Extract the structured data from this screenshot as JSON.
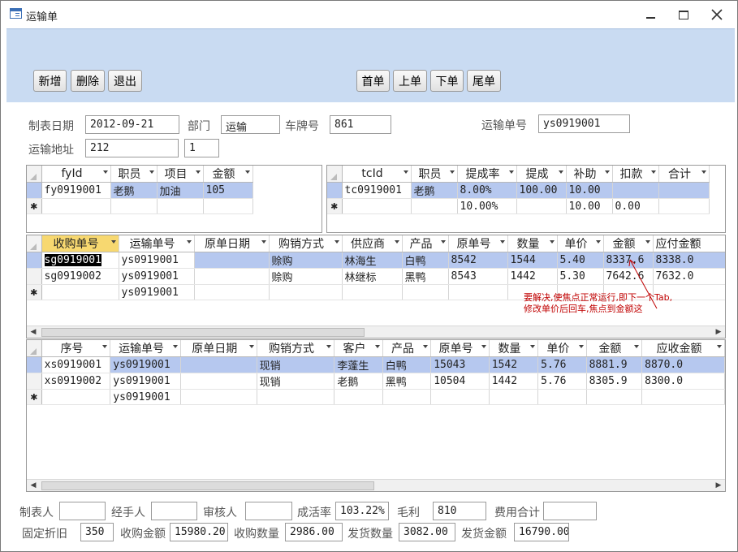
{
  "window": {
    "title": "运输单"
  },
  "toolbar": {
    "add": "新增",
    "delete": "删除",
    "exit": "退出",
    "first": "首单",
    "prev": "上单",
    "next": "下单",
    "last": "尾单"
  },
  "form": {
    "date_label": "制表日期",
    "date_value": "2012-09-21",
    "dept_label": "部门",
    "dept_value": "运输",
    "plate_label": "车牌号",
    "plate_value": "861",
    "order_no_label": "运输单号",
    "order_no_value": "ys0919001",
    "address_label": "运输地址",
    "address_value": "212",
    "address_extra": "1"
  },
  "fee_grid": {
    "columns": [
      "fyId",
      "职员",
      "项目",
      "金额"
    ],
    "rows": [
      [
        "fy0919001",
        "老鹅",
        "加油",
        "105"
      ]
    ]
  },
  "comm_grid": {
    "columns": [
      "tcId",
      "职员",
      "提成率",
      "提成",
      "补助",
      "扣款",
      "合计"
    ],
    "rows": [
      [
        "tc0919001",
        "老鹅",
        "8.00%",
        "100.00",
        "10.00",
        "",
        ""
      ]
    ],
    "new_row": [
      "",
      "",
      "10.00%",
      "",
      "10.00",
      "0.00",
      ""
    ]
  },
  "purchase_grid": {
    "columns": [
      "收购单号",
      "运输单号",
      "原单日期",
      "购销方式",
      "供应商",
      "产品",
      "原单号",
      "数量",
      "单价",
      "金额",
      "应付金额"
    ],
    "rows": [
      [
        "sg0919001",
        "ys0919001",
        "",
        "赊购",
        "林海生",
        "白鸭",
        "8542",
        "1544",
        "5.40",
        "8337.6",
        "8338.0"
      ],
      [
        "sg0919002",
        "ys0919001",
        "",
        "赊购",
        "林继标",
        "黑鸭",
        "8543",
        "1442",
        "5.30",
        "7642.6",
        "7632.0"
      ]
    ],
    "new_row": [
      "",
      "ys0919001",
      "",
      "",
      "",
      "",
      "",
      "",
      "",
      "",
      ""
    ]
  },
  "annotation": {
    "line1": "要解决,使焦点正常运行,即下一个Tab,",
    "line2": "修改单价后回车,焦点到金额这"
  },
  "sales_grid": {
    "columns": [
      "序号",
      "运输单号",
      "原单日期",
      "购销方式",
      "客户",
      "产品",
      "原单号",
      "数量",
      "单价",
      "金额",
      "应收金额"
    ],
    "rows": [
      [
        "xs0919001",
        "ys0919001",
        "",
        "现销",
        "李蓬生",
        "白鸭",
        "15043",
        "1542",
        "5.76",
        "8881.9",
        "8870.0"
      ],
      [
        "xs0919002",
        "ys0919001",
        "",
        "现销",
        "老鹅",
        "黑鸭",
        "10504",
        "1442",
        "5.76",
        "8305.9",
        "8300.0"
      ]
    ],
    "new_row": [
      "",
      "ys0919001",
      "",
      "",
      "",
      "",
      "",
      "",
      "",
      "",
      ""
    ]
  },
  "footer": {
    "maker_label": "制表人",
    "maker_value": "",
    "handler_label": "经手人",
    "handler_value": "",
    "reviewer_label": "审核人",
    "reviewer_value": "",
    "survival_label": "成活率",
    "survival_value": "103.22%",
    "profit_label": "毛利",
    "profit_value": "810",
    "fee_total_label": "费用合计",
    "fee_total_value": "",
    "depr_label": "固定折旧",
    "depr_value": "350",
    "buy_amount_label": "收购金额",
    "buy_amount_value": "15980.20",
    "buy_qty_label": "收购数量",
    "buy_qty_value": "2986.00",
    "ship_qty_label": "发货数量",
    "ship_qty_value": "3082.00",
    "ship_amount_label": "发货金额",
    "ship_amount_value": "16790.00"
  }
}
